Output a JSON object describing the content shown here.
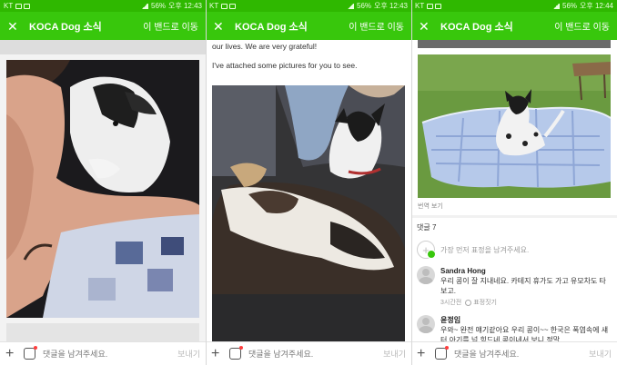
{
  "status_bars": [
    {
      "carrier": "KT",
      "battery": "56%",
      "time": "오후 12:43"
    },
    {
      "carrier": "KT",
      "battery": "56%",
      "time": "오후 12:43"
    },
    {
      "carrier": "KT",
      "battery": "56%",
      "time": "오후 12:44"
    }
  ],
  "app_bar": {
    "title": "KOCA Dog 소식",
    "band_link": "이 밴드로 이동",
    "close_icon": "close-icon"
  },
  "post_text": {
    "line1": "our lives. We are very grateful!",
    "line2": "I've attached some pictures for you to see."
  },
  "photo_caption": "번역 보기",
  "comments": {
    "count_label": "댓글 7",
    "empty_prompt": "가장 먼저 표정을 남겨주세요.",
    "items": [
      {
        "author": "Sandra Hong",
        "text": "우리 콩이 잘 지내네요. 카테지 휴가도 가고 유모차도 타보고.",
        "time": "3시간전",
        "react_label": "표정짓기"
      },
      {
        "author": "윤정임",
        "text": "우와~ 완전 얘기같아요 우리 콩이~~ 한국은 폭염속에 섀터 아기를 넘 힘드네 콩이네서 보니 정말",
        "time": "",
        "react_label": ""
      }
    ]
  },
  "bottom_bar": {
    "placeholder": "댓글을 남겨주세요.",
    "send": "보내기"
  },
  "colors": {
    "status": "#2fb800",
    "appbar": "#38c70c",
    "accent": "#38c70c"
  }
}
